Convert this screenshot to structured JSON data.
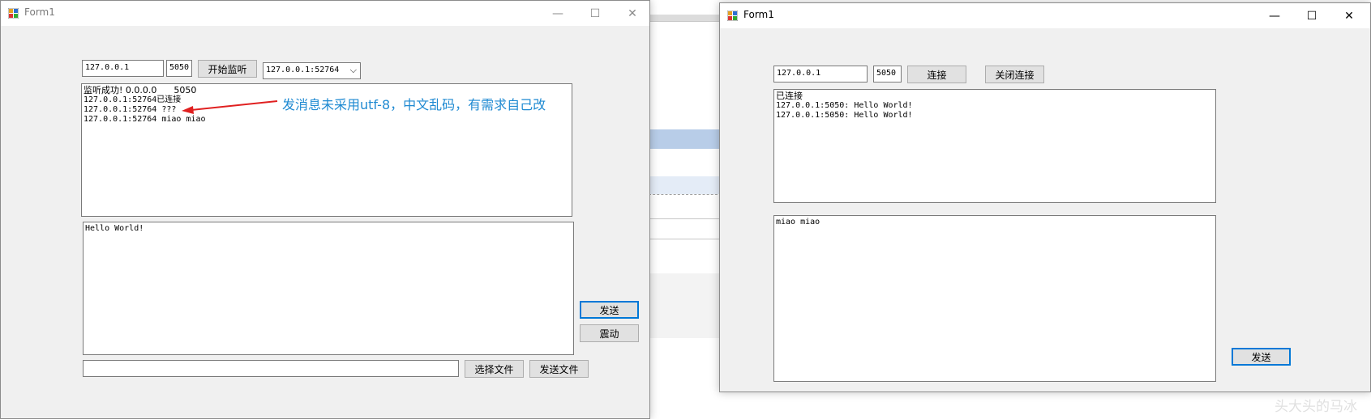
{
  "left_window": {
    "title": "Form1",
    "caption": {
      "minimize": "—",
      "maximize": "☐",
      "close": "✕"
    },
    "ip": "127.0.0.1",
    "port": "5050",
    "listen_button": "开始监听",
    "client_select": "127.0.0.1:52764",
    "log": [
      "监听成功! 0.0.0.0      5050",
      "127.0.0.1:52764已连接",
      "127.0.0.1:52764 ???",
      "127.0.0.1:52764 miao miao"
    ],
    "message": "Hello World!",
    "send_button": "发送",
    "shake_button": "震动",
    "file_path": "",
    "choose_file_button": "选择文件",
    "send_file_button": "发送文件"
  },
  "annotation": "发消息未采用utf-8，中文乱码，有需求自己改",
  "right_window": {
    "title": "Form1",
    "caption": {
      "minimize": "—",
      "maximize": "☐",
      "close": "✕"
    },
    "ip": "127.0.0.1",
    "port": "5050",
    "connect_button": "连接",
    "close_connect_button": "关闭连接",
    "log": [
      "已连接",
      "127.0.0.1:5050: Hello World!",
      "127.0.0.1:5050: Hello World!"
    ],
    "message": "miao miao",
    "send_button": "发送"
  },
  "colors": {
    "annotation": "#1f8ad2",
    "arrow": "#e02020",
    "default_button_border": "#0078d7"
  }
}
